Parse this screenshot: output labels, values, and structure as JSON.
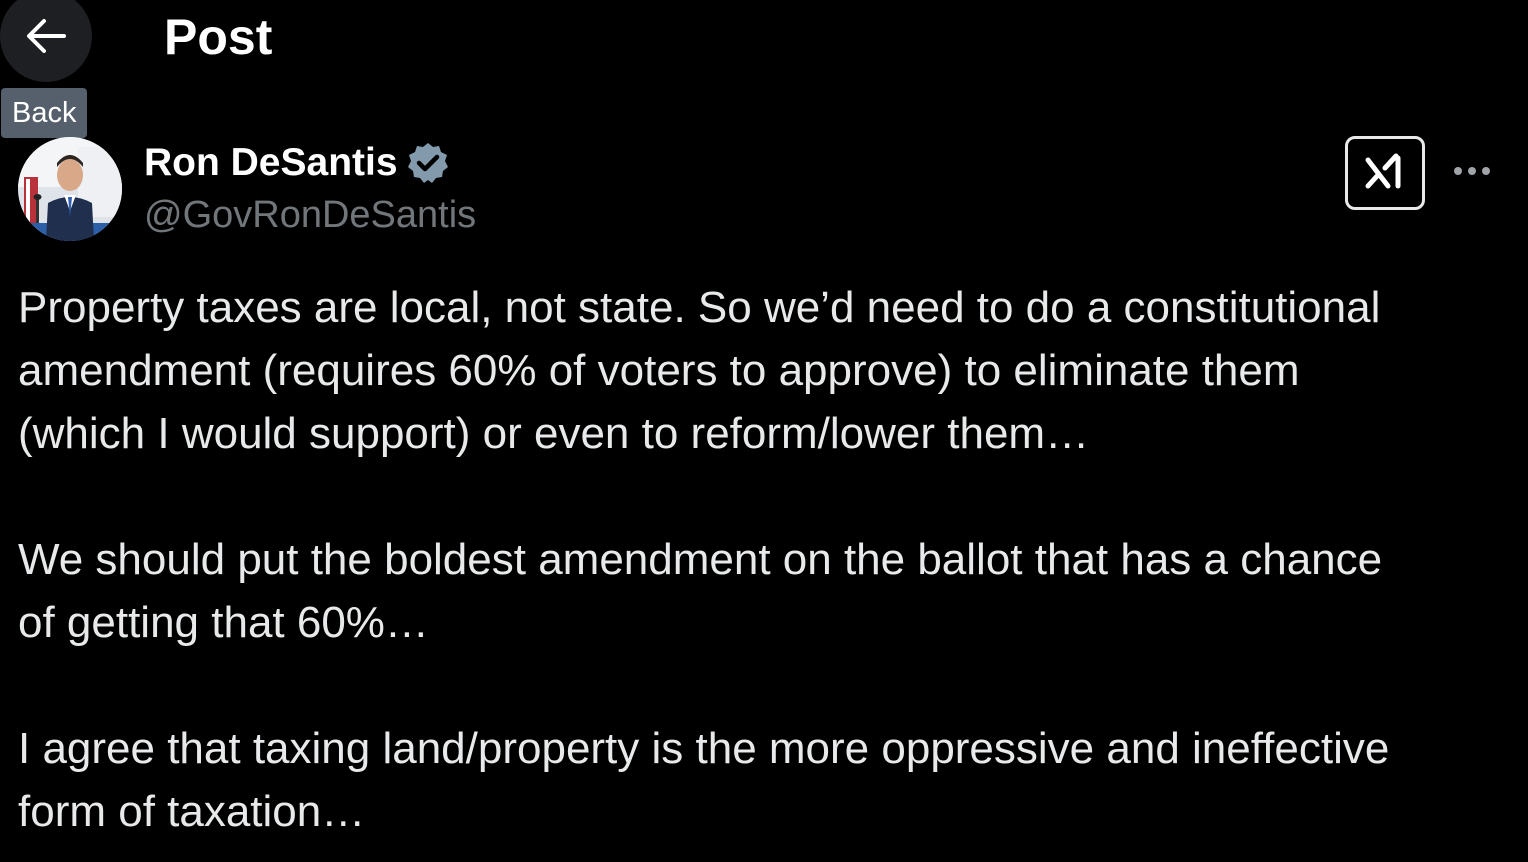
{
  "header": {
    "back_tooltip": "Back",
    "title": "Post"
  },
  "author": {
    "display_name": "Ron DeSantis",
    "handle": "@GovRonDeSantis",
    "verified": true,
    "verified_color": "#829aab"
  },
  "actions": {
    "grok_icon": "grok-icon",
    "more_icon": "more-horizontal-icon"
  },
  "post": {
    "paragraphs": [
      "Property taxes are local, not state.  So we’d need to do a constitutional\namendment (requires 60% of voters to approve) to eliminate them\n(which I would support) or even to reform/lower them…",
      "We should put the boldest amendment on the ballot that has a chance\nof getting that 60%…",
      "I agree that taxing land/property is the more oppressive and ineffective\nform of taxation…"
    ]
  },
  "colors": {
    "background": "#000000",
    "text_primary": "#e7e9ea",
    "text_secondary": "#71767b",
    "tooltip_bg": "#55606c"
  }
}
